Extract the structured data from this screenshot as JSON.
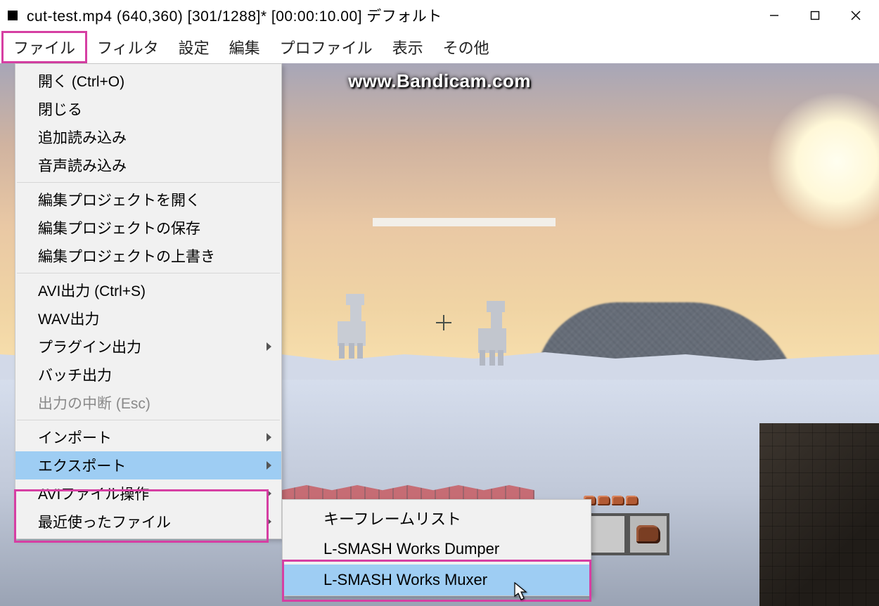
{
  "title": "cut-test.mp4 (640,360)  [301/1288]* [00:00:10.00]  デフォルト",
  "menubar": [
    "ファイル",
    "フィルタ",
    "設定",
    "編集",
    "プロファイル",
    "表示",
    "その他"
  ],
  "watermark": "www.Bandicam.com",
  "file_menu": {
    "groups": [
      [
        "開く (Ctrl+O)",
        "閉じる",
        "追加読み込み",
        "音声読み込み"
      ],
      [
        "編集プロジェクトを開く",
        "編集プロジェクトの保存",
        "編集プロジェクトの上書き"
      ],
      [
        "AVI出力 (Ctrl+S)",
        "WAV出力",
        "プラグイン出力",
        "バッチ出力",
        "出力の中断 (Esc)"
      ],
      [
        "インポート",
        "エクスポート",
        "AVIファイル操作",
        "最近使ったファイル"
      ]
    ],
    "has_submenu": [
      "プラグイン出力",
      "インポート",
      "エクスポート",
      "AVIファイル操作",
      "最近使ったファイル"
    ],
    "disabled": [
      "出力の中断 (Esc)"
    ],
    "highlighted": "エクスポート"
  },
  "export_submenu": {
    "items": [
      "キーフレームリスト",
      "L-SMASH Works Dumper",
      "L-SMASH Works Muxer"
    ],
    "highlighted": "L-SMASH Works Muxer"
  }
}
